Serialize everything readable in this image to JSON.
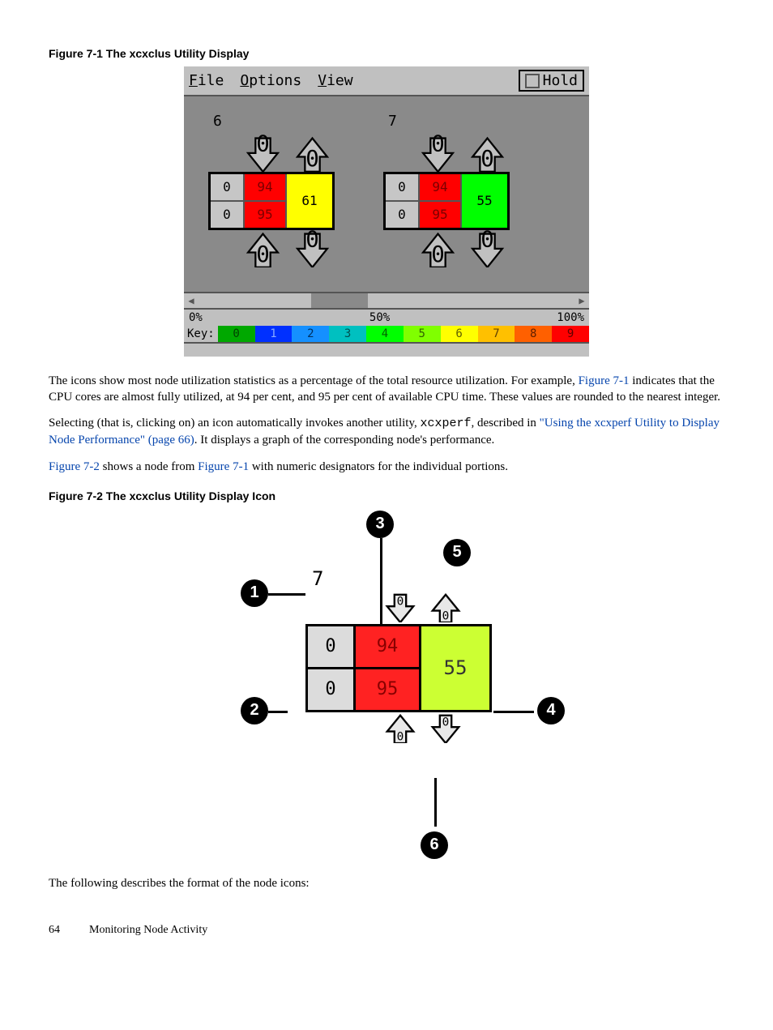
{
  "figure1": {
    "caption": "Figure 7-1 The xcxclus Utility Display",
    "menu": {
      "file": "File",
      "options": "Options",
      "view": "View",
      "hold": "Hold"
    },
    "nodes": [
      {
        "id": "6",
        "io": [
          "0",
          "0"
        ],
        "cpu": [
          "94",
          "95"
        ],
        "mem": "61",
        "memClass": "mem-yellow",
        "arrows_top": [
          "0",
          "0"
        ],
        "arrows_bottom": [
          "0",
          "0"
        ]
      },
      {
        "id": "7",
        "io": [
          "0",
          "0"
        ],
        "cpu": [
          "94",
          "95"
        ],
        "mem": "55",
        "memClass": "mem-green",
        "arrows_top": [
          "0",
          "0"
        ],
        "arrows_bottom": [
          "0",
          "0"
        ]
      }
    ],
    "scale": {
      "min": "0%",
      "mid": "50%",
      "max": "100%"
    },
    "key_label": "Key:",
    "key": [
      {
        "n": "0",
        "bg": "#00a800",
        "fg": "#004000"
      },
      {
        "n": "1",
        "bg": "#0030ff",
        "fg": "#88aaff"
      },
      {
        "n": "2",
        "bg": "#1590ff",
        "fg": "#003060"
      },
      {
        "n": "3",
        "bg": "#00c0c0",
        "fg": "#005050"
      },
      {
        "n": "4",
        "bg": "#00ff00",
        "fg": "#006000"
      },
      {
        "n": "5",
        "bg": "#80ff00",
        "fg": "#306000"
      },
      {
        "n": "6",
        "bg": "#ffff00",
        "fg": "#606000"
      },
      {
        "n": "7",
        "bg": "#ffc000",
        "fg": "#604000"
      },
      {
        "n": "8",
        "bg": "#ff6000",
        "fg": "#602000"
      },
      {
        "n": "9",
        "bg": "#ff0000",
        "fg": "#600000"
      }
    ]
  },
  "para1a": "The icons show most node utilization statistics as a percentage of the total resource utilization. For example, ",
  "para1_link": "Figure 7-1",
  "para1b": " indicates that the CPU cores are almost fully utilized, at 94 per cent, and 95 per cent of available CPU time. These values are rounded to the nearest integer.",
  "para2a": "Selecting (that is, clicking on) an icon automatically invokes another utility, ",
  "para2_code": "xcxperf",
  "para2b": ", described in ",
  "para2_link": "\"Using the xcxperf Utility to Display Node Performance\" (page 66)",
  "para2c": ". It displays a graph of the corresponding node's performance.",
  "para3a_link": "Figure 7-2",
  "para3b": " shows a node from ",
  "para3c_link": "Figure 7-1",
  "para3d": " with numeric designators for the individual portions.",
  "figure2": {
    "caption": "Figure 7-2 The xcxclus Utility Display Icon",
    "node": {
      "id": "7",
      "io": [
        "0",
        "0"
      ],
      "cpu": [
        "94",
        "95"
      ],
      "mem": "55",
      "arrows_top": [
        "0",
        "0"
      ],
      "arrows_bottom": [
        "0",
        "0"
      ]
    },
    "callouts": [
      "1",
      "2",
      "3",
      "4",
      "5",
      "6"
    ]
  },
  "para4": "The following describes the format of the node icons:",
  "footer": {
    "page": "64",
    "section": "Monitoring Node Activity"
  }
}
